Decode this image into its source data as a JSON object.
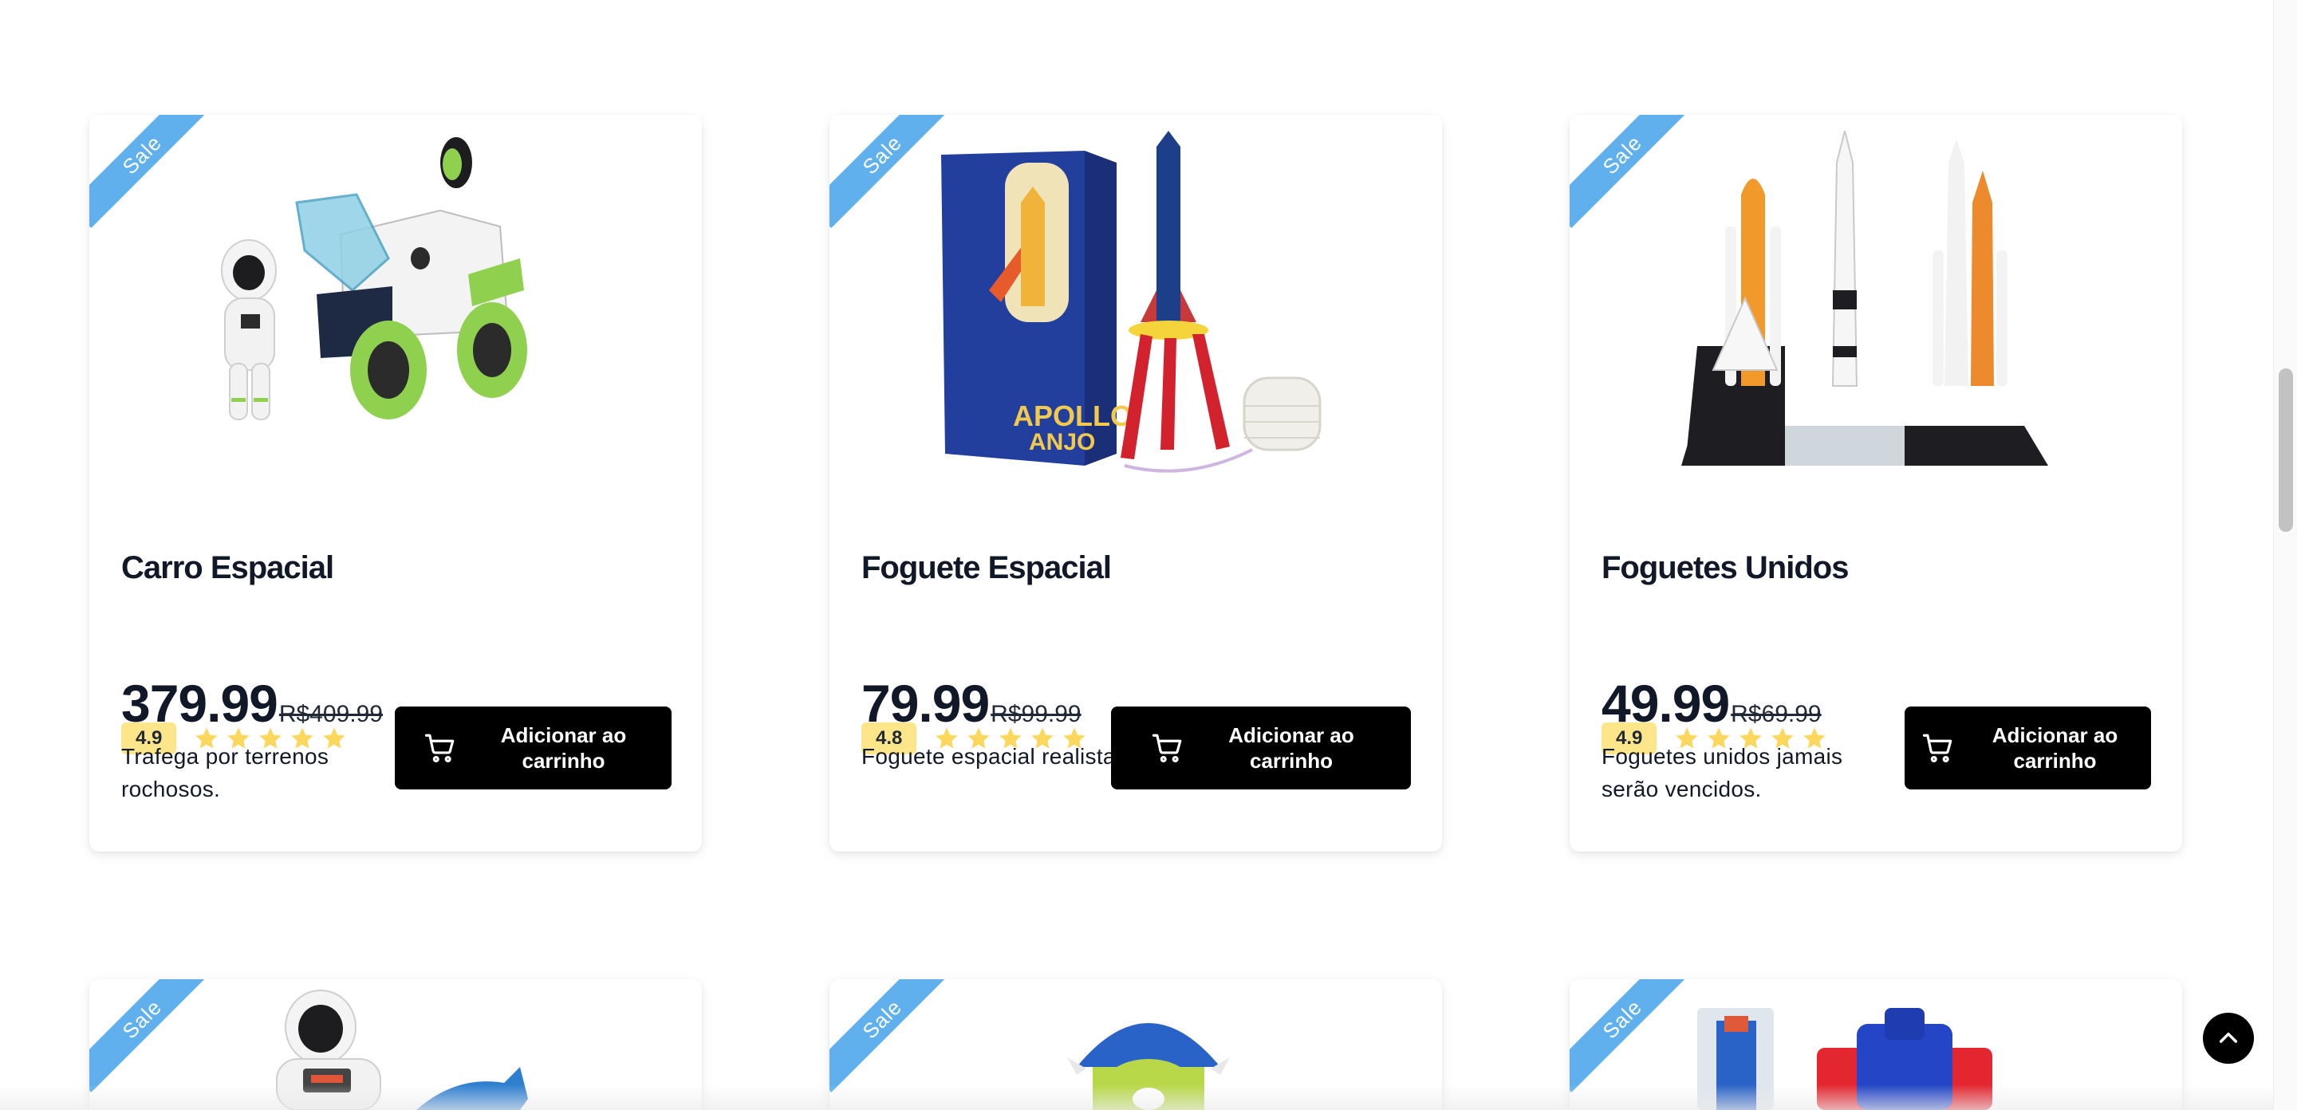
{
  "sale_label": "Sale",
  "colors": {
    "ribbon": "#5fb0ec",
    "rating_badge": "#fde68a",
    "star": "#fbd85d",
    "button": "#000000"
  },
  "products": [
    {
      "name": "Carro Espacial",
      "rating": "4.9",
      "stars": 5,
      "price": "379.99",
      "old_price": "R$409.99",
      "description": "Trafega por terrenos rochosos.",
      "button_label": "Adicionar ao carrinho",
      "image_icon": "space-car-image"
    },
    {
      "name": "Foguete Espacial",
      "rating": "4.8",
      "stars": 5,
      "price": "79.99",
      "old_price": "R$99.99",
      "description": "Foguete espacial realista.",
      "button_label": "Adicionar ao carrinho",
      "image_icon": "rocket-kit-image"
    },
    {
      "name": "Foguetes Unidos",
      "rating": "4.9",
      "stars": 5,
      "price": "49.99",
      "old_price": "R$69.99",
      "description": "Foguetes unidos jamais serão vencidos.",
      "button_label": "Adicionar ao carrinho",
      "image_icon": "rockets-set-image"
    }
  ],
  "next_row": [
    {
      "image_icon": "astronaut-toy-image"
    },
    {
      "image_icon": "monster-toy-image"
    },
    {
      "image_icon": "robot-toy-image"
    }
  ],
  "back_to_top_icon": "chevron-up-icon"
}
